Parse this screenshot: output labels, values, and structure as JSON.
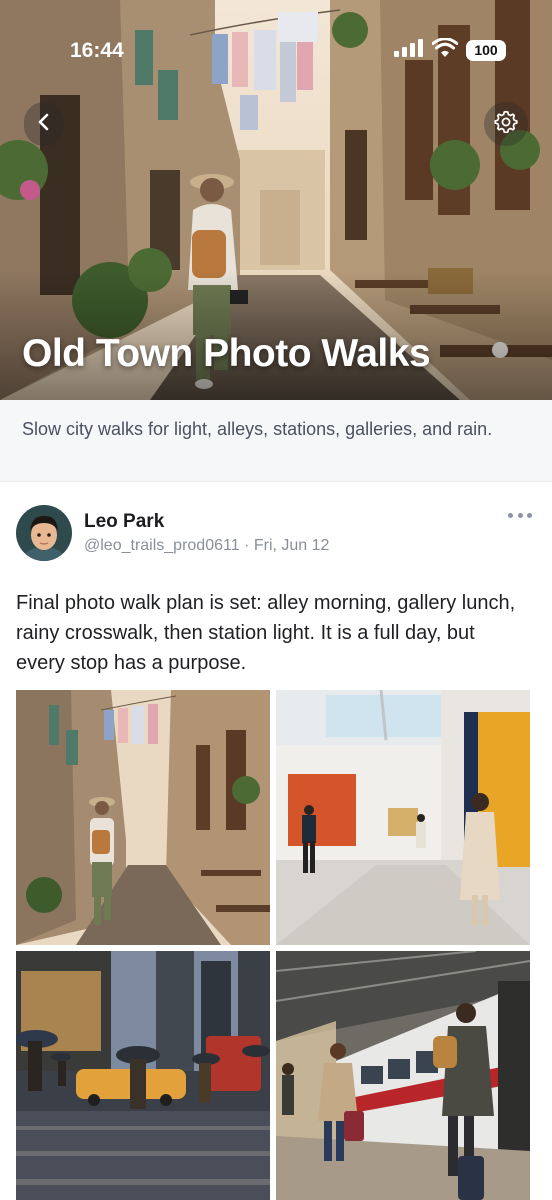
{
  "status_bar": {
    "time": "16:44",
    "battery": "100",
    "icons": [
      "cellular-signal-icon",
      "wifi-icon",
      "battery-icon"
    ]
  },
  "hero": {
    "title": "Old Town Photo Walks",
    "back_icon": "chevron-left-icon",
    "settings_icon": "gear-icon"
  },
  "description": "Slow city walks for light, alleys, stations, galleries, and rain.",
  "post": {
    "author": {
      "name": "Leo Park",
      "handle": "@leo_trails_prod0611",
      "separator": "·",
      "date": "Fri, Jun 12"
    },
    "more_icon": "more-horizontal-icon",
    "text": "Final photo walk plan is set: alley morning, gallery lunch, rainy crosswalk, then station light. It is a full day, but every stop has a purpose.",
    "photos": [
      "alley-morning",
      "gallery-lunch",
      "rainy-crosswalk",
      "station-light"
    ]
  },
  "colors": {
    "background": "#ffffff",
    "description_bg": "#f6f7f9",
    "muted_text": "#8a8f99",
    "body_text": "#1f2024"
  }
}
